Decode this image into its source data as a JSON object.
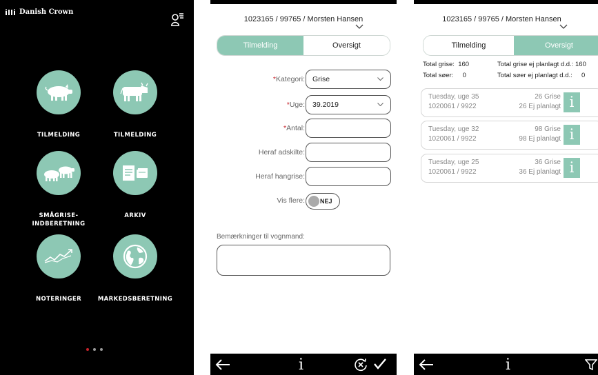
{
  "home": {
    "brand": "Danish Crown",
    "tiles": [
      {
        "label": "TILMELDING",
        "icon": "pig-icon"
      },
      {
        "label": "TILMELDING",
        "icon": "cow-icon"
      },
      {
        "label": "SMÅGRISE-\nINDBERETNING",
        "icon": "piglets-icon"
      },
      {
        "label": "ARKIV",
        "icon": "archive-icon"
      },
      {
        "label": "NOTERINGER",
        "icon": "trend-chart-icon"
      },
      {
        "label": "MARKEDSBERETNING",
        "icon": "globe-icon"
      }
    ],
    "pager": {
      "pages": 3,
      "active": 1
    }
  },
  "form": {
    "header": "1023165 / 99765 / Morsten Hansen",
    "tabs": {
      "active": "Tilmelding",
      "inactive": "Oversigt"
    },
    "fields": {
      "kategori": {
        "label": "Kategori:",
        "required_mark": "*",
        "value": "Grise"
      },
      "uge": {
        "label": "Uge:",
        "required_mark": "*",
        "value": "39.2019"
      },
      "antal": {
        "label": "Antal:",
        "required_mark": "*",
        "value": ""
      },
      "adskilte": {
        "label": "Heraf adskilte:",
        "value": ""
      },
      "hangrise": {
        "label": "Heraf hangrise:",
        "value": ""
      },
      "vis_flere": {
        "label": "Vis flere:",
        "toggle_text": "NEJ"
      }
    },
    "remarks_label": "Bemærkninger til vognmand:",
    "remarks_value": "",
    "colors": {
      "accent": "#8dc8b4",
      "required": "#c8232b"
    }
  },
  "overview": {
    "header": "1023165 / 99765 / Morsten Hansen",
    "tabs": {
      "inactive": "Tilmelding",
      "active": "Oversigt"
    },
    "totals": {
      "grise_label": "Total grise:",
      "grise_value": "160",
      "soer_label": "Total søer:",
      "soer_value": "0",
      "grise_ej_label": "Total grise ej planlagt d.d.:",
      "grise_ej_value": "160",
      "soer_ej_label": "Total søer ej planlagt d.d.:",
      "soer_ej_value": "0"
    },
    "entries": [
      {
        "day": "Tuesday, uge 35",
        "id": "1020061 / 9922",
        "count": "26 Grise",
        "planned": "26 Ej planlagt"
      },
      {
        "day": "Tuesday, uge 32",
        "id": "1020061 / 9922",
        "count": "98 Grise",
        "planned": "98 Ej planlagt"
      },
      {
        "day": "Tuesday, uge 25",
        "id": "1020061 / 9922",
        "count": "36 Grise",
        "planned": "36 Ej planlagt"
      }
    ],
    "info_glyph": "i"
  },
  "toolbar": {
    "info_glyph": "i"
  }
}
